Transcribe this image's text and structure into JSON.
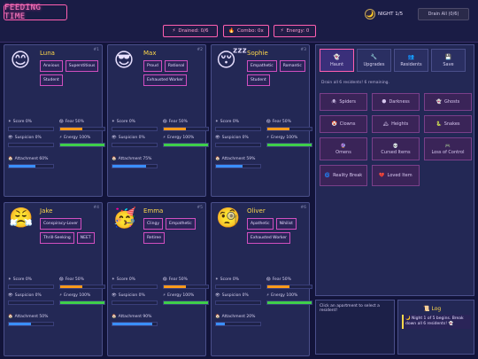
{
  "header": {
    "title": "FEEDING TIME",
    "night_label": "NIGHT 1/5",
    "moon_icon": "moon-icon",
    "drain_all_label": "Drain All (0/6)",
    "stats": [
      {
        "icon": "⚡",
        "text": "Drained: 0/6"
      },
      {
        "icon": "🔥",
        "text": "Combo: 0x"
      },
      {
        "icon": "⚡",
        "text": "Energy: 0"
      }
    ]
  },
  "apartments": [
    {
      "num": "#1",
      "emoji": "😊",
      "name": "Luna",
      "traits": [
        "Anxious",
        "Superstitious",
        "Student"
      ],
      "score": "Score 0%",
      "fear": "Fear 50%",
      "suspicion": "Suspicion 0%",
      "energy": "Energy 100%",
      "attachment": "Attachment 60%",
      "score_v": 0,
      "fear_v": 50,
      "suspicion_v": 0,
      "energy_v": 100,
      "attachment_v": 60
    },
    {
      "num": "#2",
      "emoji": "😎",
      "name": "Max",
      "traits": [
        "Proud",
        "Rational",
        "Exhausted Worker"
      ],
      "score": "Score 0%",
      "fear": "Fear 50%",
      "suspicion": "Suspicion 0%",
      "energy": "Energy 100%",
      "attachment": "Attachment 75%",
      "score_v": 0,
      "fear_v": 50,
      "suspicion_v": 0,
      "energy_v": 100,
      "attachment_v": 75
    },
    {
      "num": "#3",
      "emoji": "😴",
      "name": "Sophie",
      "traits": [
        "Empathetic",
        "Romantic",
        "Student"
      ],
      "score": "Score 0%",
      "fear": "Fear 50%",
      "suspicion": "Suspicion 0%",
      "energy": "Energy 100%",
      "attachment": "Attachment 59%",
      "score_v": 0,
      "fear_v": 50,
      "suspicion_v": 0,
      "energy_v": 100,
      "attachment_v": 59
    },
    {
      "num": "#4",
      "emoji": "😤",
      "name": "Jake",
      "traits": [
        "Conspiracy-Lover",
        "Thrill-Seeking",
        "NEET"
      ],
      "score": "Score 0%",
      "fear": "Fear 50%",
      "suspicion": "Suspicion 0%",
      "energy": "Energy 100%",
      "attachment": "Attachment 50%",
      "score_v": 0,
      "fear_v": 50,
      "suspicion_v": 0,
      "energy_v": 100,
      "attachment_v": 50
    },
    {
      "num": "#5",
      "emoji": "🥳",
      "name": "Emma",
      "traits": [
        "Clingy",
        "Empathetic",
        "Retiree"
      ],
      "score": "Score 0%",
      "fear": "Fear 50%",
      "suspicion": "Suspicion 0%",
      "energy": "Energy 100%",
      "attachment": "Attachment 90%",
      "score_v": 0,
      "fear_v": 50,
      "suspicion_v": 0,
      "energy_v": 100,
      "attachment_v": 90
    },
    {
      "num": "#6",
      "emoji": "🧐",
      "name": "Oliver",
      "traits": [
        "Apathetic",
        "Nihilist",
        "Exhausted Worker"
      ],
      "score": "Score 0%",
      "fear": "Fear 50%",
      "suspicion": "Suspicion 0%",
      "energy": "Energy 100%",
      "attachment": "Attachment 20%",
      "score_v": 0,
      "fear_v": 50,
      "suspicion_v": 0,
      "energy_v": 100,
      "attachment_v": 20
    }
  ],
  "panel": {
    "tabs": [
      {
        "icon": "👻",
        "label": "Haunt"
      },
      {
        "icon": "🔧",
        "label": "Upgrades"
      },
      {
        "icon": "👥",
        "label": "Residents"
      },
      {
        "icon": "💾",
        "label": "Save"
      }
    ],
    "drain_info": "Drain all 6 residents! 6 remaining.",
    "scares": [
      {
        "icon": "🕷",
        "label": "Spiders"
      },
      {
        "icon": "🌑",
        "label": "Darkness"
      },
      {
        "icon": "👻",
        "label": "Ghosts"
      },
      {
        "icon": "🤡",
        "label": "Clowns"
      },
      {
        "icon": "🏔",
        "label": "Heights"
      },
      {
        "icon": "🐍",
        "label": "Snakes"
      },
      {
        "icon": "🔮",
        "label": "Omens"
      },
      {
        "icon": "💀",
        "label": "Cursed Items"
      },
      {
        "icon": "🎮",
        "label": "Loss of Control"
      },
      {
        "icon": "🌀",
        "label": "Reality Break"
      },
      {
        "icon": "💔",
        "label": "Loved Item"
      }
    ]
  },
  "info_text": "Click an apartment to select a resident!",
  "log": {
    "title": "Log",
    "entries": [
      "🌙 Night 1 of 5 begins. Break down all 6 residents! 👻"
    ]
  },
  "labels": {
    "score_icon": "score-icon",
    "fear_icon": "fear-icon"
  }
}
